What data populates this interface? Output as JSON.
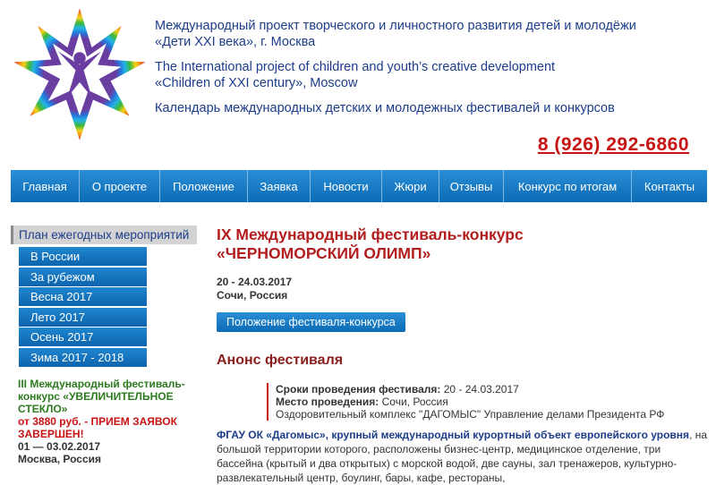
{
  "header": {
    "ru_line1": "Международный проект творческого и личностного развития детей и молодёжи",
    "ru_line2": "«Дети XXI века», г. Москва",
    "en_line1": "The International project of children and youth’s creative development",
    "en_line2": "«Children of XXI century», Moscow",
    "calendar": "Календарь международных детских и молодежных фестивалей и конкурсов",
    "phone": "8 (926) 292-6860"
  },
  "nav": {
    "items": [
      {
        "label": "Главная"
      },
      {
        "label": "О проекте"
      },
      {
        "label": "Положение"
      },
      {
        "label": "Заявка"
      },
      {
        "label": "Новости"
      },
      {
        "label": "Жюри"
      },
      {
        "label": "Отзывы"
      },
      {
        "label": "Конкурс по итогам"
      },
      {
        "label": "Контакты"
      }
    ]
  },
  "sidebar": {
    "heading": "План ежегодных мероприятий",
    "items": [
      {
        "label": "В России"
      },
      {
        "label": "За рубежом"
      },
      {
        "label": "Весна 2017"
      },
      {
        "label": "Лето 2017"
      },
      {
        "label": "Осень 2017"
      },
      {
        "label": "Зима 2017 - 2018"
      }
    ],
    "promo": {
      "title": "III Международный фестиваль-конкурс «УВЕЛИЧИТЕЛЬНОЕ СТЕКЛО»",
      "price": "от 3880 руб. - ПРИЕМ ЗАЯВОК ЗАВЕРШЕН!",
      "dates": "01 — 03.02.2017",
      "place": "Москва, Россия"
    }
  },
  "main": {
    "title_line1": "IX Международный фестиваль-конкурс",
    "title_line2": "«ЧЕРНОМОРСКИЙ ОЛИМП»",
    "dates": "20 - 24.03.2017",
    "place": "Сочи, Россия",
    "button_label": "Положение фестиваля-конкурса",
    "anons_heading": "Анонс фестиваля",
    "info": {
      "terms_label": "Сроки проведения фестиваля:",
      "terms_value": "20 - 24.03.2017",
      "place_label": "Место проведения:",
      "place_value": "Сочи, Россия",
      "venue": "Оздоровительный комплекс \"ДАГОМЫС\" Управление делами Президента РФ"
    },
    "desc_bold": "ФГАУ ОК «Дагомыс», крупный международный курортный объект европейского уровня",
    "desc_text": ", на большой территории которого, расположены бизнес-центр, медицинское отделение, три бассейна (крытый и два открытых) с морской водой, две сауны, зал тренажеров, культурно-развлекательный центр, боулинг, бары, кафе, рестораны,"
  },
  "colors": {
    "brand_blue": "#0c6bb5",
    "heading_red": "#b21e1e",
    "phone_red": "#c81313",
    "header_text": "#1c3d8a",
    "promo_green": "#2d7b1f"
  }
}
